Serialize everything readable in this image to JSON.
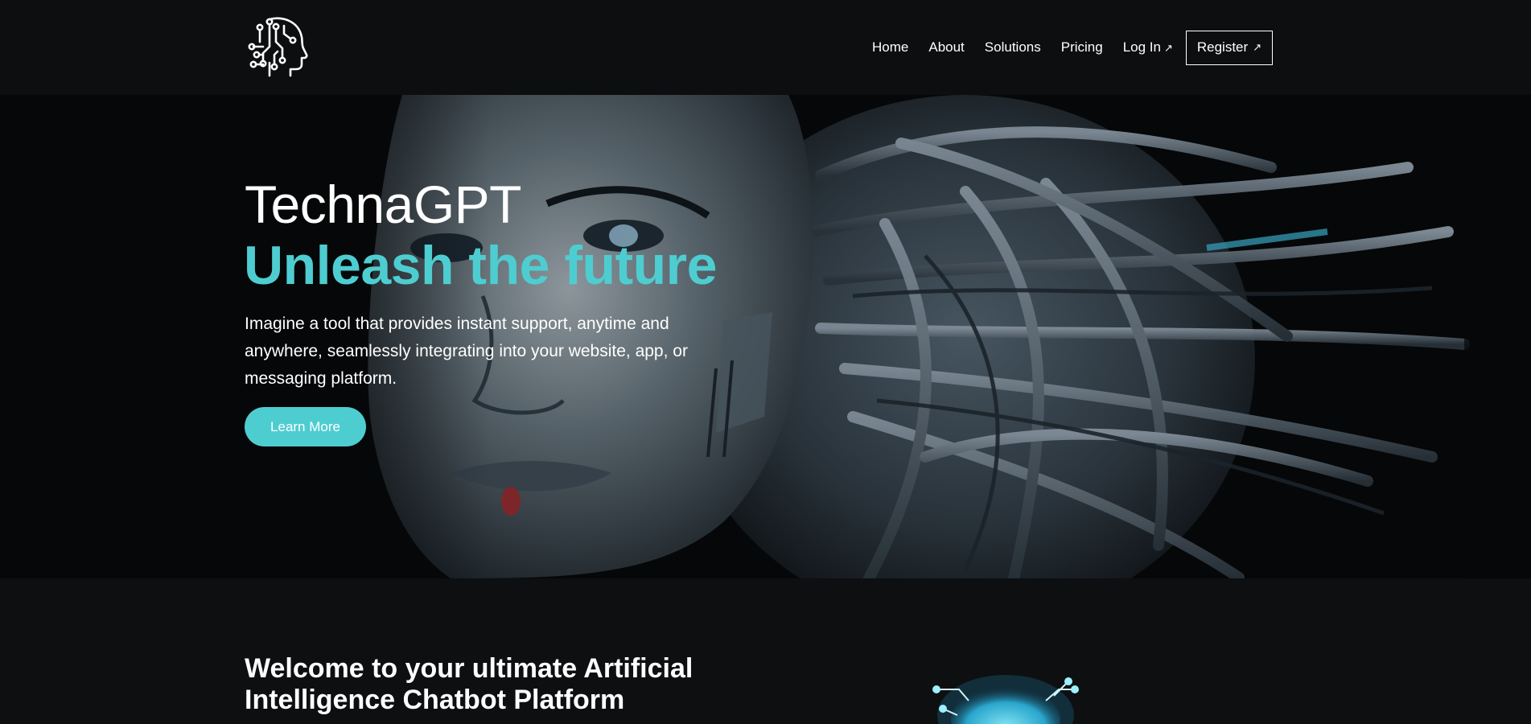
{
  "brand": {
    "logo_icon": "circuit-head-icon"
  },
  "nav": {
    "items": [
      {
        "label": "Home"
      },
      {
        "label": "About"
      },
      {
        "label": "Solutions"
      },
      {
        "label": "Pricing"
      },
      {
        "label": "Log In",
        "icon": "external-arrow-icon",
        "icon_glyph": "↗"
      }
    ],
    "register": {
      "label": "Register",
      "icon": "external-arrow-icon",
      "icon_glyph": "↗"
    }
  },
  "hero": {
    "title": "TechnaGPT",
    "tagline": "Unleash the future",
    "description": "Imagine a tool that provides instant support, anytime and anywhere, seamlessly integrating into your website, app, or messaging platform.",
    "cta_label": "Learn More",
    "image": "robot-head-image"
  },
  "welcome": {
    "title": "Welcome to your ultimate Artificial Intelligence Chatbot Platform",
    "image": "brain-network-image"
  },
  "colors": {
    "background": "#0d0e10",
    "accent": "#4ecdd1",
    "text": "#ffffff"
  }
}
